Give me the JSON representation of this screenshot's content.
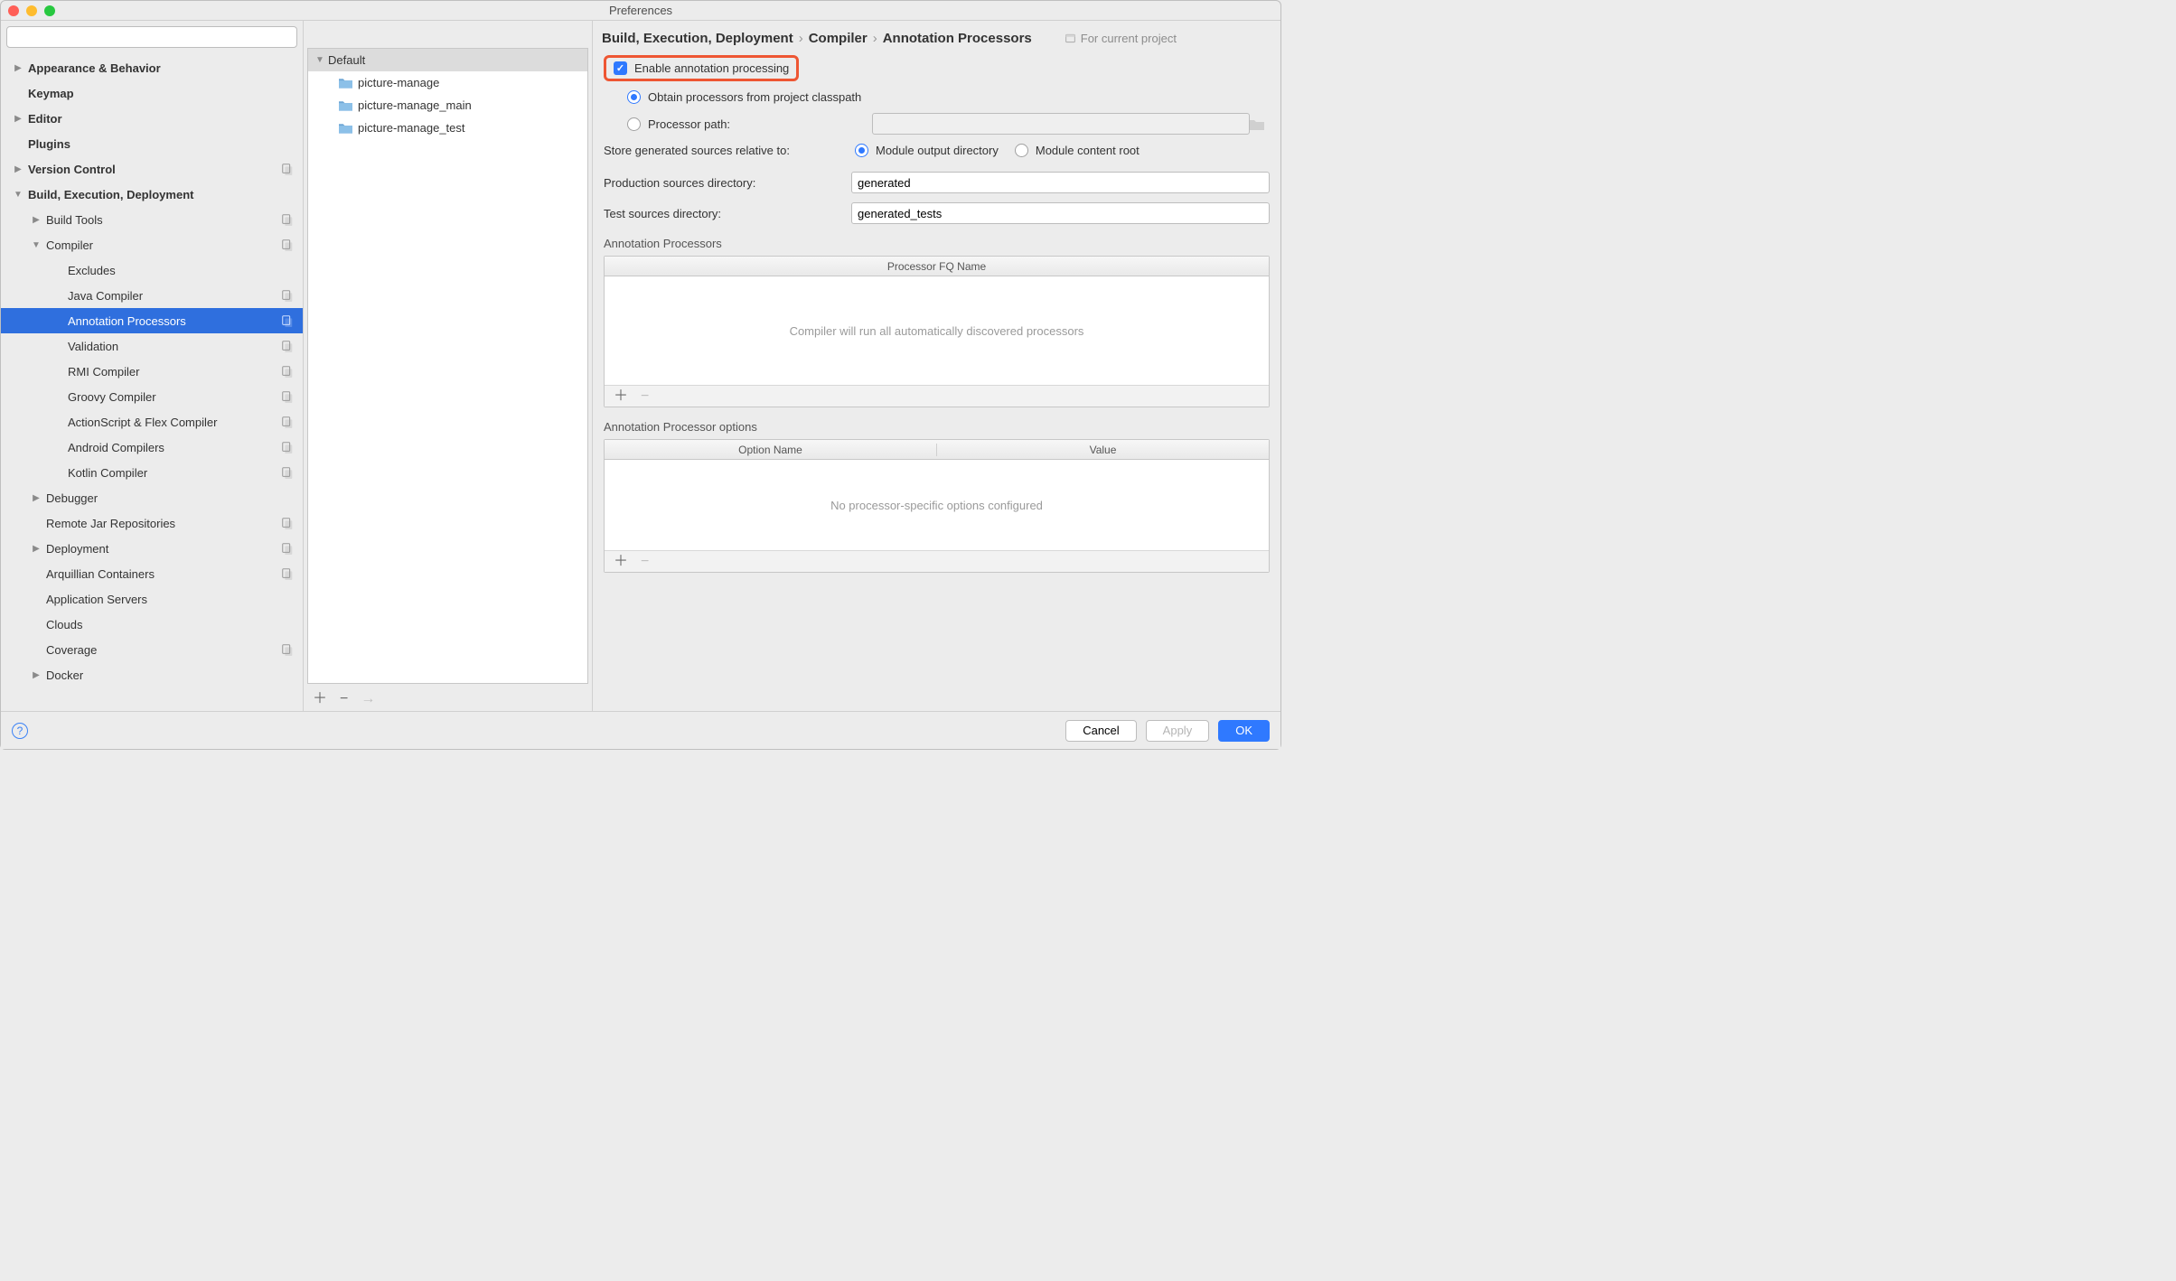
{
  "window": {
    "title": "Preferences"
  },
  "sidebar": {
    "search_placeholder": "",
    "items": [
      {
        "label": "Appearance & Behavior",
        "indent": 0,
        "bold": true,
        "arrow": "right"
      },
      {
        "label": "Keymap",
        "indent": 0,
        "bold": true
      },
      {
        "label": "Editor",
        "indent": 0,
        "bold": true,
        "arrow": "right"
      },
      {
        "label": "Plugins",
        "indent": 0,
        "bold": true
      },
      {
        "label": "Version Control",
        "indent": 0,
        "bold": true,
        "arrow": "right",
        "badge": true
      },
      {
        "label": "Build, Execution, Deployment",
        "indent": 0,
        "bold": true,
        "arrow": "down"
      },
      {
        "label": "Build Tools",
        "indent": 1,
        "arrow": "right",
        "badge": true
      },
      {
        "label": "Compiler",
        "indent": 1,
        "arrow": "down",
        "badge": true
      },
      {
        "label": "Excludes",
        "indent": 2
      },
      {
        "label": "Java Compiler",
        "indent": 2,
        "badge": true
      },
      {
        "label": "Annotation Processors",
        "indent": 2,
        "badge": true,
        "selected": true
      },
      {
        "label": "Validation",
        "indent": 2,
        "badge": true
      },
      {
        "label": "RMI Compiler",
        "indent": 2,
        "badge": true
      },
      {
        "label": "Groovy Compiler",
        "indent": 2,
        "badge": true
      },
      {
        "label": "ActionScript & Flex Compiler",
        "indent": 2,
        "badge": true
      },
      {
        "label": "Android Compilers",
        "indent": 2,
        "badge": true
      },
      {
        "label": "Kotlin Compiler",
        "indent": 2,
        "badge": true
      },
      {
        "label": "Debugger",
        "indent": 1,
        "arrow": "right"
      },
      {
        "label": "Remote Jar Repositories",
        "indent": 1,
        "badge": true
      },
      {
        "label": "Deployment",
        "indent": 1,
        "arrow": "right",
        "badge": true
      },
      {
        "label": "Arquillian Containers",
        "indent": 1,
        "badge": true
      },
      {
        "label": "Application Servers",
        "indent": 1
      },
      {
        "label": "Clouds",
        "indent": 1
      },
      {
        "label": "Coverage",
        "indent": 1,
        "badge": true
      },
      {
        "label": "Docker",
        "indent": 1,
        "arrow": "right"
      }
    ]
  },
  "center": {
    "root": "Default",
    "children": [
      "picture-manage",
      "picture-manage_main",
      "picture-manage_test"
    ]
  },
  "breadcrumb": {
    "a": "Build, Execution, Deployment",
    "b": "Compiler",
    "c": "Annotation Processors",
    "scope": "For current project"
  },
  "form": {
    "enable_label": "Enable annotation processing",
    "obtain_label": "Obtain processors from project classpath",
    "procpath_label": "Processor path:",
    "procpath_value": "",
    "store_label": "Store generated sources relative to:",
    "store_a": "Module output directory",
    "store_b": "Module content root",
    "prod_label": "Production sources directory:",
    "prod_value": "generated",
    "test_label": "Test sources directory:",
    "test_value": "generated_tests",
    "section1": "Annotation Processors",
    "tbl1_col": "Processor FQ Name",
    "tbl1_empty": "Compiler will run all automatically discovered processors",
    "section2": "Annotation Processor options",
    "tbl2_col1": "Option Name",
    "tbl2_col2": "Value",
    "tbl2_empty": "No processor-specific options configured"
  },
  "footer": {
    "cancel": "Cancel",
    "apply": "Apply",
    "ok": "OK"
  }
}
